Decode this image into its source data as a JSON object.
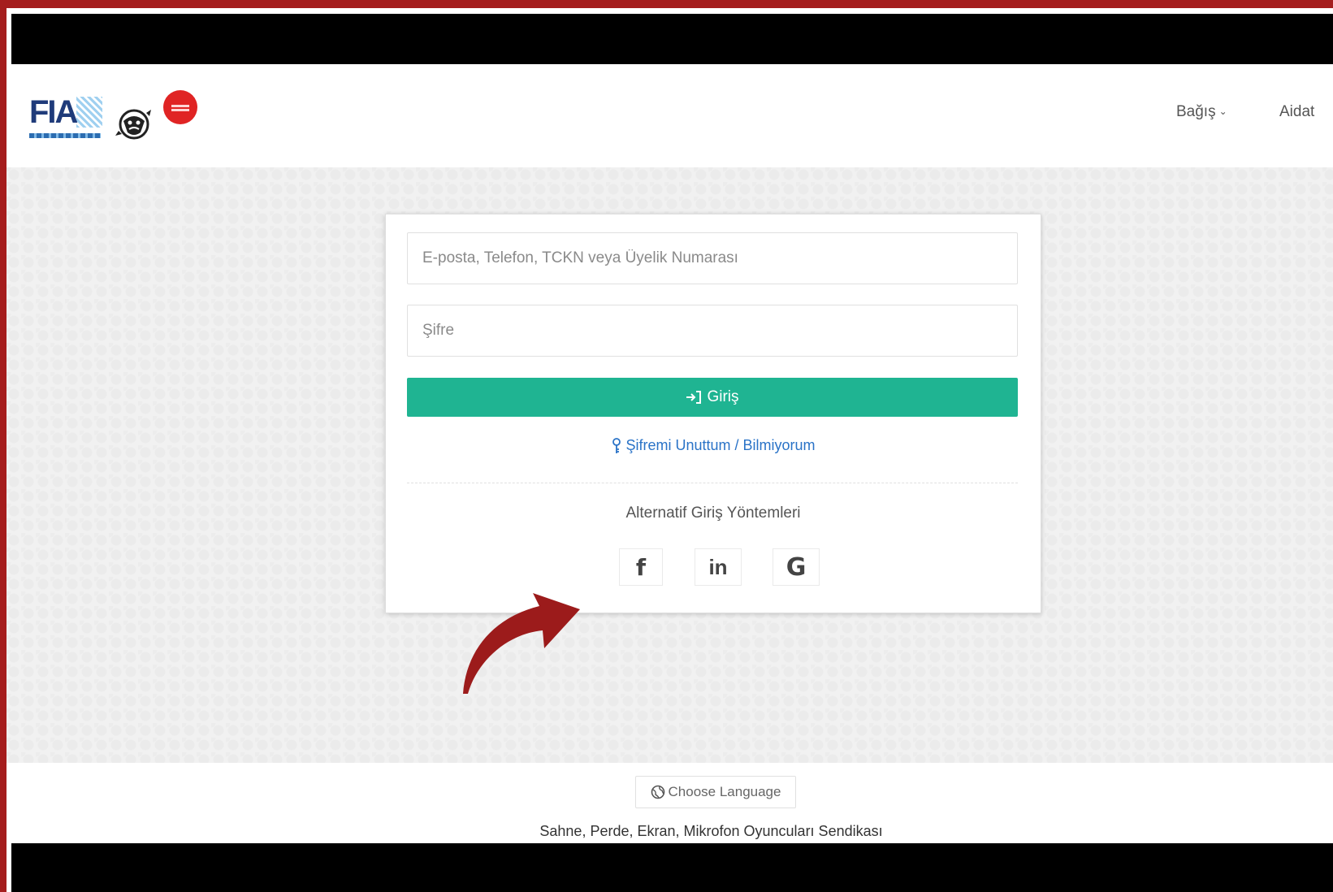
{
  "header": {
    "logo_text": "FIA",
    "nav": [
      {
        "label": "Bağış",
        "has_dropdown": true
      },
      {
        "label": "Aidat",
        "has_dropdown": false
      }
    ]
  },
  "login": {
    "email_placeholder": "E-posta, Telefon, TCKN veya Üyelik Numarası",
    "password_placeholder": "Şifre",
    "login_button": "Giriş",
    "forgot_link": "Şifremi Unuttum / Bilmiyorum",
    "alt_title": "Alternatif Giriş Yöntemleri",
    "social": [
      {
        "label": "f",
        "icon": "facebook-icon"
      },
      {
        "label": "in",
        "icon": "linkedin-icon"
      },
      {
        "label": "G",
        "icon": "google-icon"
      }
    ]
  },
  "footer": {
    "language_button": "Choose Language",
    "org_name": "Sahne, Perde, Ekran, Mikrofon Oyuncuları Sendikası"
  },
  "colors": {
    "border": "#a51d1d",
    "primary_button": "#1fb492",
    "link": "#2a73c7",
    "annotation_arrow": "#9c1b1b"
  }
}
